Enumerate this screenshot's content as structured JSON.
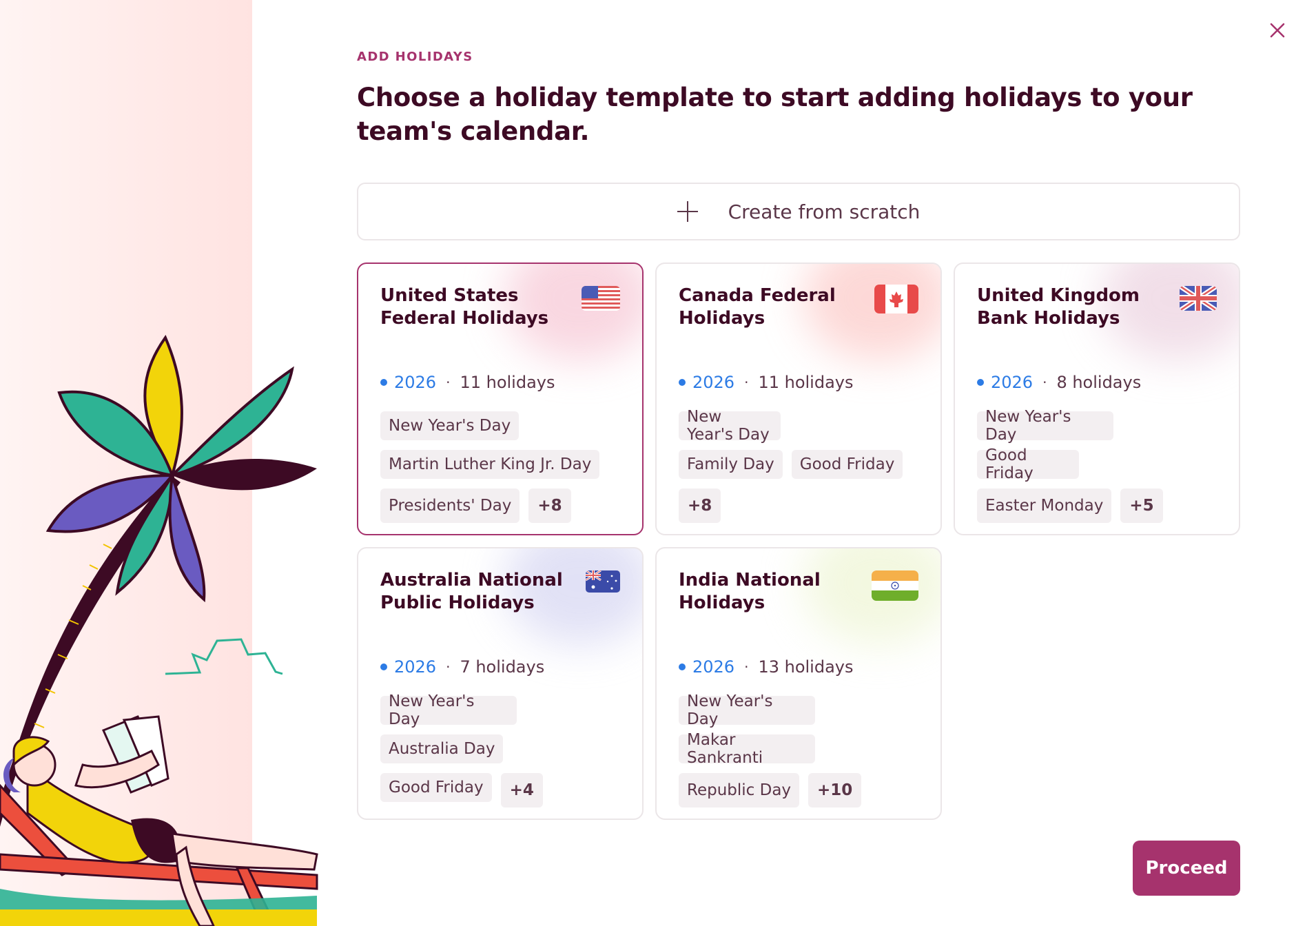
{
  "header": {
    "eyebrow": "ADD HOLIDAYS",
    "title": "Choose a holiday template to start adding holidays to your team's calendar."
  },
  "scratch": {
    "label": "Create from scratch",
    "icon": "plus-icon"
  },
  "templates": [
    {
      "title": "United States Federal Holidays",
      "flag": "us-flag-icon",
      "year": "2026",
      "count": "11 holidays",
      "chips": [
        "New Year's Day",
        "Martin Luther King Jr. Day",
        "Presidents' Day"
      ],
      "more": "+8",
      "selected": true,
      "glow": "#f4b6c8"
    },
    {
      "title": "Canada Federal Holidays",
      "flag": "canada-flag-icon",
      "year": "2026",
      "count": "11 holidays",
      "chips": [
        "New Year's Day",
        "Family Day",
        "Good Friday"
      ],
      "more": "+8",
      "selected": false,
      "glow": "#fbb9b6"
    },
    {
      "title": "United Kingdom Bank Holidays",
      "flag": "uk-flag-icon",
      "year": "2026",
      "count": "8 holidays",
      "chips": [
        "New Year's Day",
        "Good Friday",
        "Easter Monday"
      ],
      "more": "+5",
      "selected": false,
      "glow": "#e6c4d6"
    },
    {
      "title": "Australia National Public Holidays",
      "flag": "australia-flag-icon",
      "year": "2026",
      "count": "7 holidays",
      "chips": [
        "New Year's Day",
        "Australia Day",
        "Good Friday"
      ],
      "more": "+4",
      "selected": false,
      "glow": "#c9c9ee"
    },
    {
      "title": "India National Holidays",
      "flag": "india-flag-icon",
      "year": "2026",
      "count": "13 holidays",
      "chips": [
        "New Year's Day",
        "Makar Sankranti",
        "Republic Day"
      ],
      "more": "+10",
      "selected": false,
      "glow": "#e9f2c7"
    }
  ],
  "actions": {
    "proceed": "Proceed"
  },
  "colors": {
    "accent": "#a6336d",
    "heading": "#3d0a24",
    "year": "#2c7be5",
    "chip_bg": "#f3eff1"
  }
}
